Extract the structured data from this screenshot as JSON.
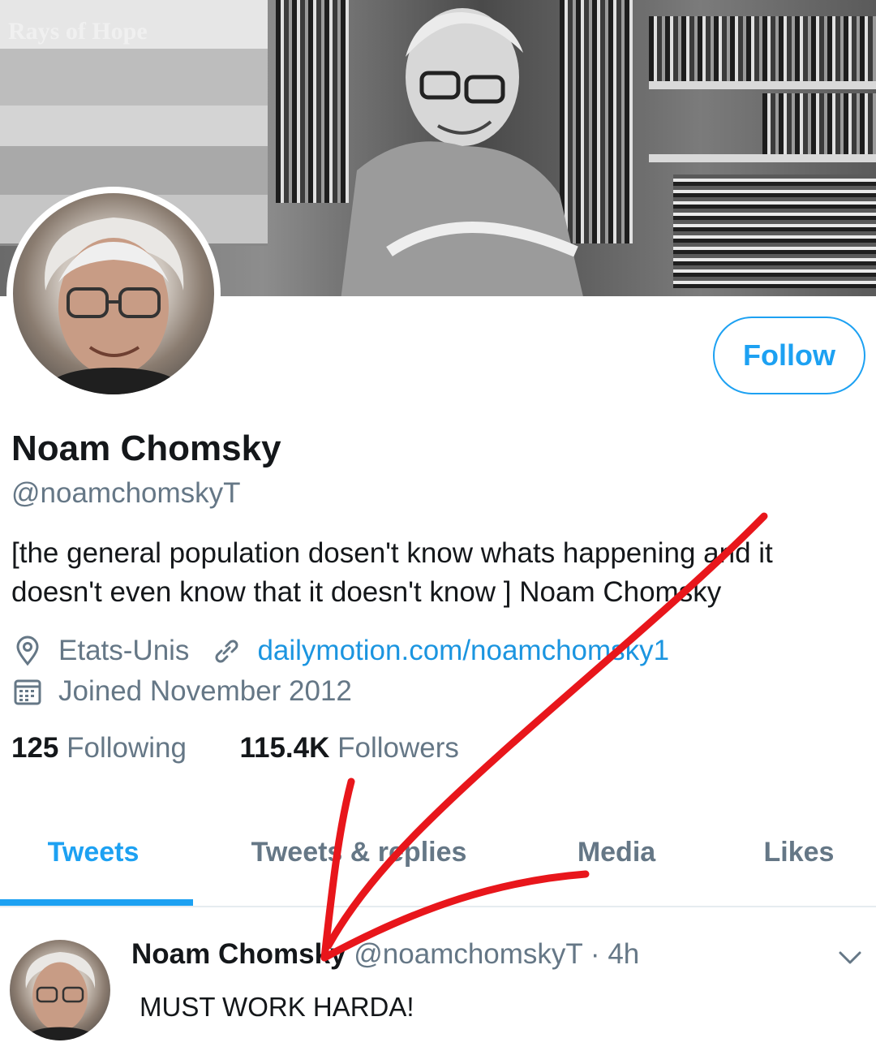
{
  "banner": {
    "caption": "Rays of Hope"
  },
  "profile": {
    "name": "Noam Chomsky",
    "handle": "@noamchomskyT",
    "bio": "[the general population dosen't know whats happening and it doesn't even know that it doesn't know ] Noam Chomsky",
    "location": "Etats-Unis",
    "website": "dailymotion.com/noamchomsky1",
    "joined": "Joined November 2012",
    "following_count": "125",
    "following_label": "Following",
    "followers_count": "115.4K",
    "followers_label": "Followers",
    "follow_button": "Follow"
  },
  "tabs": [
    {
      "label": "Tweets",
      "active": true
    },
    {
      "label": "Tweets & replies",
      "active": false
    },
    {
      "label": "Media",
      "active": false
    },
    {
      "label": "Likes",
      "active": false
    }
  ],
  "tweet": {
    "author": "Noam Chomsky",
    "handle": "@noamchomskyT",
    "separator": "·",
    "time": "4h",
    "text": "MUST WORK HARDA!"
  },
  "icons": {
    "location": "location-pin-icon",
    "website": "link-icon",
    "joined": "calendar-icon",
    "menu": "chevron-down-icon"
  },
  "colors": {
    "accent": "#1da1f2",
    "link": "#1b95e0",
    "secondary_text": "#657786",
    "annotation": "#e8161b"
  }
}
